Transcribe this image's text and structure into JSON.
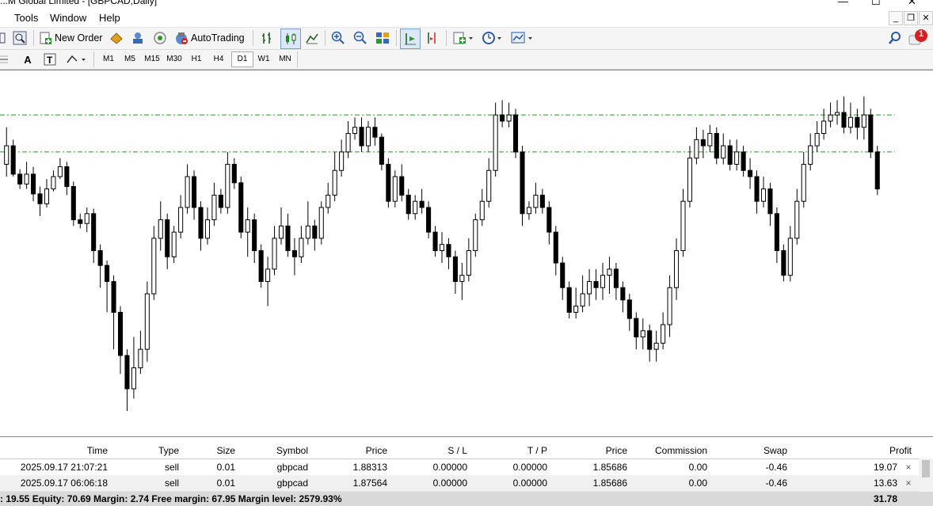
{
  "window": {
    "title": "...M Global Limited - [GBPCAD,Daily]"
  },
  "menu": {
    "items": [
      "Tools",
      "Window",
      "Help"
    ]
  },
  "toolbar": {
    "new_order": "New Order",
    "auto_trading": "AutoTrading"
  },
  "timeframes": [
    "M1",
    "M5",
    "M15",
    "M30",
    "H1",
    "H4",
    "D1",
    "W1",
    "MN"
  ],
  "selected_timeframe": "D1",
  "notification_badge": "1",
  "colors": {
    "bull": "#ffffff",
    "bear": "#000000",
    "level_line": "#1a9c1a",
    "summary_bg": "#d9d9d9"
  },
  "chart_data": {
    "type": "candlestick",
    "symbol": "GBPCAD",
    "period": "Daily",
    "levels": [
      0.8,
      0.5
    ],
    "candles": [
      [
        0.4,
        0.55,
        0.7,
        0.3
      ],
      [
        0.55,
        0.32,
        0.6,
        0.3
      ],
      [
        0.32,
        0.24,
        0.36,
        0.2
      ],
      [
        0.24,
        0.32,
        0.42,
        0.2
      ],
      [
        0.32,
        0.16,
        0.38,
        0.1
      ],
      [
        0.16,
        0.08,
        0.22,
        -0.02
      ],
      [
        0.08,
        0.2,
        0.28,
        0.05
      ],
      [
        0.2,
        0.3,
        0.35,
        0.18
      ],
      [
        0.3,
        0.38,
        0.45,
        0.28
      ],
      [
        0.38,
        0.22,
        0.42,
        0.15
      ],
      [
        0.22,
        -0.05,
        0.26,
        -0.1
      ],
      [
        -0.05,
        -0.08,
        0.0,
        -0.12
      ],
      [
        -0.08,
        0.0,
        0.05,
        -0.15
      ],
      [
        0.0,
        -0.3,
        0.04,
        -0.4
      ],
      [
        -0.3,
        -0.42,
        -0.25,
        -0.6
      ],
      [
        -0.42,
        -0.55,
        -0.38,
        -0.8
      ],
      [
        -0.55,
        -0.8,
        -0.5,
        -1.1
      ],
      [
        -0.8,
        -1.15,
        -0.75,
        -1.3
      ],
      [
        -1.15,
        -1.42,
        -1.1,
        -1.6
      ],
      [
        -1.42,
        -1.25,
        -1.0,
        -1.5
      ],
      [
        -1.25,
        -1.1,
        -0.95,
        -1.3
      ],
      [
        -1.1,
        -0.65,
        -0.55,
        -1.2
      ],
      [
        -0.65,
        -0.2,
        -0.1,
        -0.7
      ],
      [
        -0.2,
        -0.05,
        0.1,
        -0.3
      ],
      [
        -0.05,
        -0.35,
        0.0,
        -0.45
      ],
      [
        -0.35,
        -0.15,
        -0.1,
        -0.4
      ],
      [
        -0.15,
        0.05,
        0.15,
        -0.2
      ],
      [
        0.05,
        0.3,
        0.4,
        0.0
      ],
      [
        0.3,
        0.05,
        0.35,
        -0.05
      ],
      [
        0.05,
        -0.2,
        0.1,
        -0.3
      ],
      [
        -0.2,
        -0.05,
        0.05,
        -0.25
      ],
      [
        -0.05,
        0.15,
        0.25,
        -0.1
      ],
      [
        0.15,
        0.05,
        0.2,
        0.0
      ],
      [
        0.05,
        0.4,
        0.5,
        0.0
      ],
      [
        0.4,
        0.25,
        0.45,
        0.2
      ],
      [
        0.25,
        -0.15,
        0.3,
        -0.2
      ],
      [
        -0.15,
        -0.05,
        0.05,
        -0.35
      ],
      [
        -0.05,
        -0.3,
        0.0,
        -0.4
      ],
      [
        -0.3,
        -0.55,
        -0.25,
        -0.6
      ],
      [
        -0.55,
        -0.45,
        -0.35,
        -0.75
      ],
      [
        -0.45,
        -0.2,
        -0.1,
        -0.5
      ],
      [
        -0.2,
        -0.1,
        0.05,
        -0.25
      ],
      [
        -0.1,
        -0.3,
        0.0,
        -0.35
      ],
      [
        -0.3,
        -0.35,
        -0.2,
        -0.5
      ],
      [
        -0.35,
        -0.2,
        -0.1,
        -0.4
      ],
      [
        -0.2,
        -0.1,
        0.1,
        -0.25
      ],
      [
        -0.1,
        -0.2,
        -0.05,
        -0.3
      ],
      [
        -0.2,
        0.05,
        0.1,
        -0.25
      ],
      [
        0.05,
        0.15,
        0.25,
        0.0
      ],
      [
        0.15,
        0.35,
        0.5,
        0.1
      ],
      [
        0.35,
        0.5,
        0.6,
        0.3
      ],
      [
        0.5,
        0.65,
        0.75,
        0.45
      ],
      [
        0.65,
        0.7,
        0.78,
        0.6
      ],
      [
        0.7,
        0.55,
        0.78,
        0.5
      ],
      [
        0.55,
        0.7,
        0.75,
        0.5
      ],
      [
        0.7,
        0.62,
        0.78,
        0.55
      ],
      [
        0.62,
        0.4,
        0.65,
        0.35
      ],
      [
        0.4,
        0.1,
        0.45,
        0.05
      ],
      [
        0.1,
        0.3,
        0.35,
        0.05
      ],
      [
        0.3,
        0.15,
        0.4,
        0.1
      ],
      [
        0.15,
        0.0,
        0.2,
        -0.05
      ],
      [
        0.0,
        0.1,
        0.15,
        -0.05
      ],
      [
        0.1,
        0.05,
        0.2,
        0.0
      ],
      [
        0.05,
        -0.15,
        0.1,
        -0.2
      ],
      [
        -0.15,
        -0.3,
        -0.1,
        -0.35
      ],
      [
        -0.3,
        -0.25,
        -0.15,
        -0.4
      ],
      [
        -0.25,
        -0.35,
        -0.2,
        -0.45
      ],
      [
        -0.35,
        -0.55,
        -0.3,
        -0.65
      ],
      [
        -0.55,
        -0.5,
        -0.4,
        -0.7
      ],
      [
        -0.5,
        -0.3,
        -0.2,
        -0.55
      ],
      [
        -0.3,
        -0.05,
        0.0,
        -0.35
      ],
      [
        -0.05,
        0.1,
        0.2,
        -0.1
      ],
      [
        0.1,
        0.35,
        0.45,
        0.05
      ],
      [
        0.35,
        0.8,
        0.9,
        0.3
      ],
      [
        0.8,
        0.75,
        0.92,
        0.7
      ],
      [
        0.75,
        0.8,
        0.9,
        0.7
      ],
      [
        0.8,
        0.5,
        0.85,
        0.45
      ],
      [
        0.5,
        0.0,
        0.55,
        -0.1
      ],
      [
        0.0,
        0.05,
        0.1,
        -0.05
      ],
      [
        0.05,
        0.15,
        0.25,
        0.0
      ],
      [
        0.15,
        0.05,
        0.2,
        0.0
      ],
      [
        0.05,
        -0.15,
        0.1,
        -0.25
      ],
      [
        -0.15,
        -0.4,
        -0.1,
        -0.5
      ],
      [
        -0.4,
        -0.6,
        -0.35,
        -0.7
      ],
      [
        -0.6,
        -0.8,
        -0.55,
        -0.85
      ],
      [
        -0.8,
        -0.75,
        -0.6,
        -0.85
      ],
      [
        -0.75,
        -0.65,
        -0.5,
        -0.8
      ],
      [
        -0.65,
        -0.55,
        -0.45,
        -0.75
      ],
      [
        -0.55,
        -0.6,
        -0.45,
        -0.7
      ],
      [
        -0.6,
        -0.5,
        -0.4,
        -0.7
      ],
      [
        -0.5,
        -0.45,
        -0.35,
        -0.65
      ],
      [
        -0.45,
        -0.6,
        -0.4,
        -0.7
      ],
      [
        -0.6,
        -0.7,
        -0.55,
        -0.8
      ],
      [
        -0.7,
        -0.85,
        -0.65,
        -0.95
      ],
      [
        -0.85,
        -1.0,
        -0.8,
        -1.1
      ],
      [
        -1.0,
        -0.95,
        -0.85,
        -1.1
      ],
      [
        -0.95,
        -1.1,
        -0.9,
        -1.2
      ],
      [
        -1.1,
        -1.05,
        -0.95,
        -1.2
      ],
      [
        -1.05,
        -0.9,
        -0.8,
        -1.1
      ],
      [
        -0.9,
        -0.6,
        -0.5,
        -1.0
      ],
      [
        -0.6,
        -0.3,
        -0.2,
        -0.7
      ],
      [
        -0.3,
        0.1,
        0.2,
        -0.35
      ],
      [
        0.1,
        0.45,
        0.55,
        0.05
      ],
      [
        0.45,
        0.6,
        0.7,
        0.4
      ],
      [
        0.6,
        0.55,
        0.68,
        0.45
      ],
      [
        0.55,
        0.65,
        0.72,
        0.5
      ],
      [
        0.65,
        0.45,
        0.7,
        0.4
      ],
      [
        0.45,
        0.55,
        0.65,
        0.4
      ],
      [
        0.55,
        0.4,
        0.6,
        0.35
      ],
      [
        0.4,
        0.5,
        0.6,
        0.35
      ],
      [
        0.5,
        0.35,
        0.55,
        0.3
      ],
      [
        0.35,
        0.3,
        0.45,
        0.2
      ],
      [
        0.3,
        0.1,
        0.35,
        0.0
      ],
      [
        0.1,
        0.2,
        0.3,
        0.05
      ],
      [
        0.2,
        0.0,
        0.25,
        -0.1
      ],
      [
        0.0,
        -0.3,
        0.05,
        -0.4
      ],
      [
        -0.3,
        -0.5,
        -0.25,
        -0.55
      ],
      [
        -0.5,
        -0.2,
        -0.1,
        -0.55
      ],
      [
        -0.2,
        0.1,
        0.2,
        -0.25
      ],
      [
        0.1,
        0.4,
        0.5,
        0.05
      ],
      [
        0.4,
        0.55,
        0.65,
        0.35
      ],
      [
        0.55,
        0.65,
        0.75,
        0.5
      ],
      [
        0.65,
        0.75,
        0.85,
        0.6
      ],
      [
        0.75,
        0.8,
        0.9,
        0.7
      ],
      [
        0.8,
        0.82,
        0.92,
        0.72
      ],
      [
        0.82,
        0.7,
        0.95,
        0.65
      ],
      [
        0.7,
        0.78,
        0.9,
        0.65
      ],
      [
        0.78,
        0.7,
        0.85,
        0.6
      ],
      [
        0.7,
        0.8,
        0.95,
        0.6
      ],
      [
        0.8,
        0.5,
        0.85,
        0.45
      ],
      [
        0.5,
        0.2,
        0.55,
        0.15
      ]
    ]
  },
  "trade_table": {
    "headers": [
      "Time",
      "Type",
      "Size",
      "Symbol",
      "Price",
      "S / L",
      "T / P",
      "Price",
      "Commission",
      "Swap",
      "Profit"
    ],
    "rows": [
      [
        "2025.09.17 21:07:21",
        "sell",
        "0.01",
        "gbpcad",
        "1.88313",
        "0.00000",
        "0.00000",
        "1.85686",
        "0.00",
        "-0.46",
        "19.07"
      ],
      [
        "2025.09.17 06:06:18",
        "sell",
        "0.01",
        "gbpcad",
        "1.87564",
        "0.00000",
        "0.00000",
        "1.85686",
        "0.00",
        "-0.46",
        "13.63"
      ]
    ],
    "close_icon": "×"
  },
  "summary": {
    "text": ": 19.55  Equity: 70.69  Margin: 2.74  Free margin: 67.95  Margin level: 2579.93%",
    "total_profit": "31.78"
  }
}
